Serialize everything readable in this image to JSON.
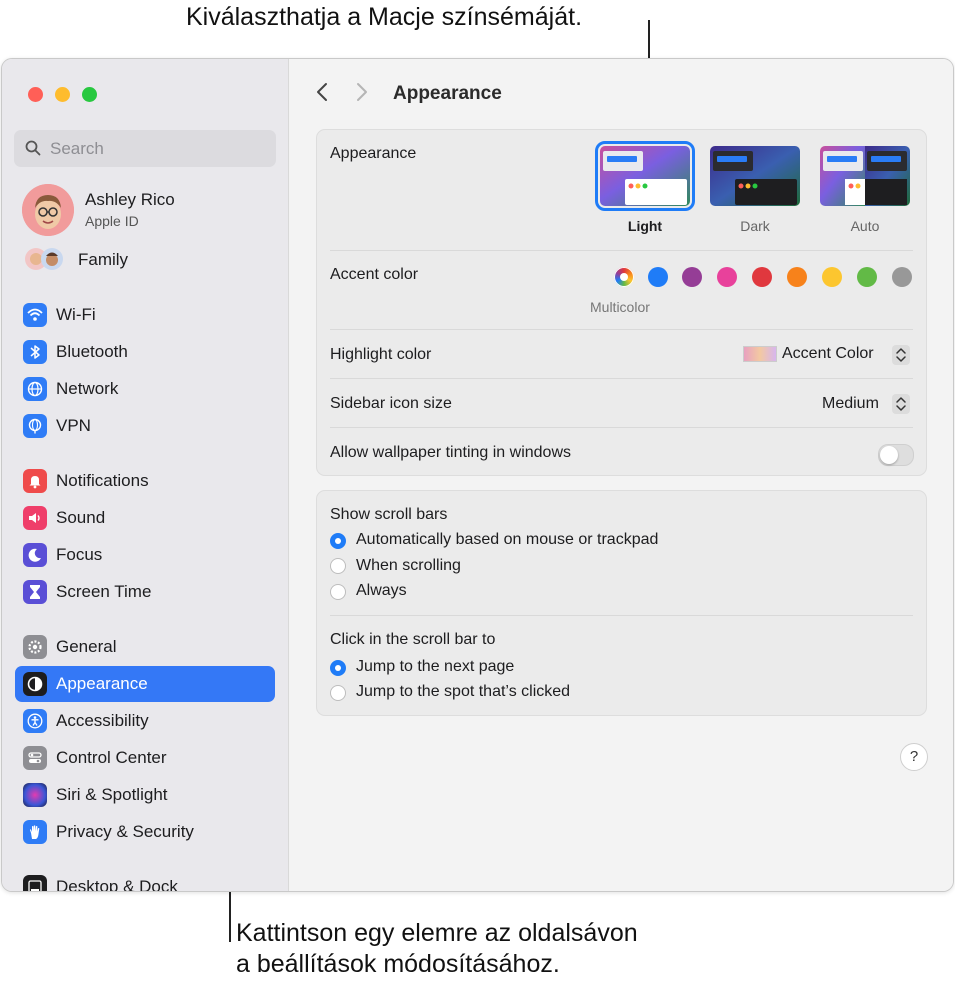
{
  "callouts": {
    "top": "Kiválaszthatja a Macje színsémáját.",
    "bottom_line1": "Kattintson egy elemre az oldalsávon",
    "bottom_line2": "a beállítások módosításához."
  },
  "sidebar": {
    "search_placeholder": "Search",
    "profile": {
      "name": "Ashley Rico",
      "subtitle": "Apple ID"
    },
    "family_label": "Family",
    "items": [
      {
        "label": "Wi-Fi",
        "icon": "wifi-icon",
        "color": "#2f7cf6"
      },
      {
        "label": "Bluetooth",
        "icon": "bluetooth-icon",
        "color": "#2f7cf6"
      },
      {
        "label": "Network",
        "icon": "globe-icon",
        "color": "#2f7cf6"
      },
      {
        "label": "VPN",
        "icon": "vpn-globe-icon",
        "color": "#2f7cf6"
      },
      {
        "label": "Notifications",
        "icon": "bell-icon",
        "color": "#ef4b4b"
      },
      {
        "label": "Sound",
        "icon": "speaker-icon",
        "color": "#ef3e6a"
      },
      {
        "label": "Focus",
        "icon": "moon-icon",
        "color": "#5a4fd6"
      },
      {
        "label": "Screen Time",
        "icon": "hourglass-icon",
        "color": "#5a4fd6"
      },
      {
        "label": "General",
        "icon": "gear-icon",
        "color": "#8e8e93"
      },
      {
        "label": "Appearance",
        "icon": "appearance-icon",
        "color": "#1d1d1f",
        "selected": true
      },
      {
        "label": "Accessibility",
        "icon": "accessibility-icon",
        "color": "#2f7cf6"
      },
      {
        "label": "Control Center",
        "icon": "control-center-icon",
        "color": "#8e8e93"
      },
      {
        "label": "Siri & Spotlight",
        "icon": "siri-icon",
        "color": "#6b3fc9"
      },
      {
        "label": "Privacy & Security",
        "icon": "hand-icon",
        "color": "#2f7cf6"
      },
      {
        "label": "Desktop & Dock",
        "icon": "dock-icon",
        "color": "#1d1d1f"
      }
    ]
  },
  "header": {
    "title": "Appearance"
  },
  "appearance": {
    "label": "Appearance",
    "options": [
      {
        "label": "Light",
        "selected": true
      },
      {
        "label": "Dark"
      },
      {
        "label": "Auto"
      }
    ]
  },
  "accent": {
    "label": "Accent color",
    "selected_label": "Multicolor",
    "colors": [
      "multicolor",
      "#1f7cf7",
      "#953d96",
      "#e8419b",
      "#e0383e",
      "#f7821b",
      "#fcc62f",
      "#62ba46",
      "#989898"
    ]
  },
  "highlight": {
    "label": "Highlight color",
    "value": "Accent Color"
  },
  "sidebar_icon_size": {
    "label": "Sidebar icon size",
    "value": "Medium"
  },
  "wallpaper_tinting": {
    "label": "Allow wallpaper tinting in windows",
    "enabled": false
  },
  "scroll_bars": {
    "label": "Show scroll bars",
    "options": [
      {
        "label": "Automatically based on mouse or trackpad",
        "selected": true
      },
      {
        "label": "When scrolling"
      },
      {
        "label": "Always"
      }
    ]
  },
  "click_scroll": {
    "label": "Click in the scroll bar to",
    "options": [
      {
        "label": "Jump to the next page",
        "selected": true
      },
      {
        "label": "Jump to the spot that’s clicked"
      }
    ]
  },
  "help": {
    "label": "?"
  }
}
